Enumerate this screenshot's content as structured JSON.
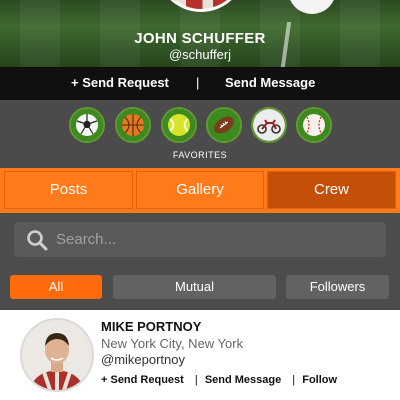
{
  "profile": {
    "name": "JOHN SCHUFFER",
    "handle": "@schufferj"
  },
  "actions": {
    "send_request": "+ Send Request",
    "separator": "|",
    "send_message": "Send Message"
  },
  "favorites": {
    "label": "FAVORITES",
    "items": [
      {
        "icon": "soccer-ball-icon"
      },
      {
        "icon": "basketball-icon"
      },
      {
        "icon": "tennis-ball-icon"
      },
      {
        "icon": "football-icon"
      },
      {
        "icon": "motorcycle-icon"
      },
      {
        "icon": "baseball-icon"
      }
    ]
  },
  "tabs": [
    {
      "label": "Posts",
      "active": false
    },
    {
      "label": "Gallery",
      "active": false
    },
    {
      "label": "Crew",
      "active": true
    }
  ],
  "search": {
    "placeholder": "Search..."
  },
  "filters": [
    {
      "label": "All",
      "active": true
    },
    {
      "label": "Mutual",
      "active": false
    },
    {
      "label": "Followers",
      "active": false
    }
  ],
  "results": [
    {
      "name": "MIKE PORTNOY",
      "location": "New York City, New York",
      "handle": "@mikeportnoy",
      "send_request": "+ Send Request",
      "send_message": "Send Message",
      "follow": "Follow",
      "separator": "|"
    }
  ],
  "colors": {
    "accent": "#ff7a1a",
    "accent_active": "#c44f06",
    "dark_bar": "#101010",
    "panel": "#4c4c4c"
  }
}
